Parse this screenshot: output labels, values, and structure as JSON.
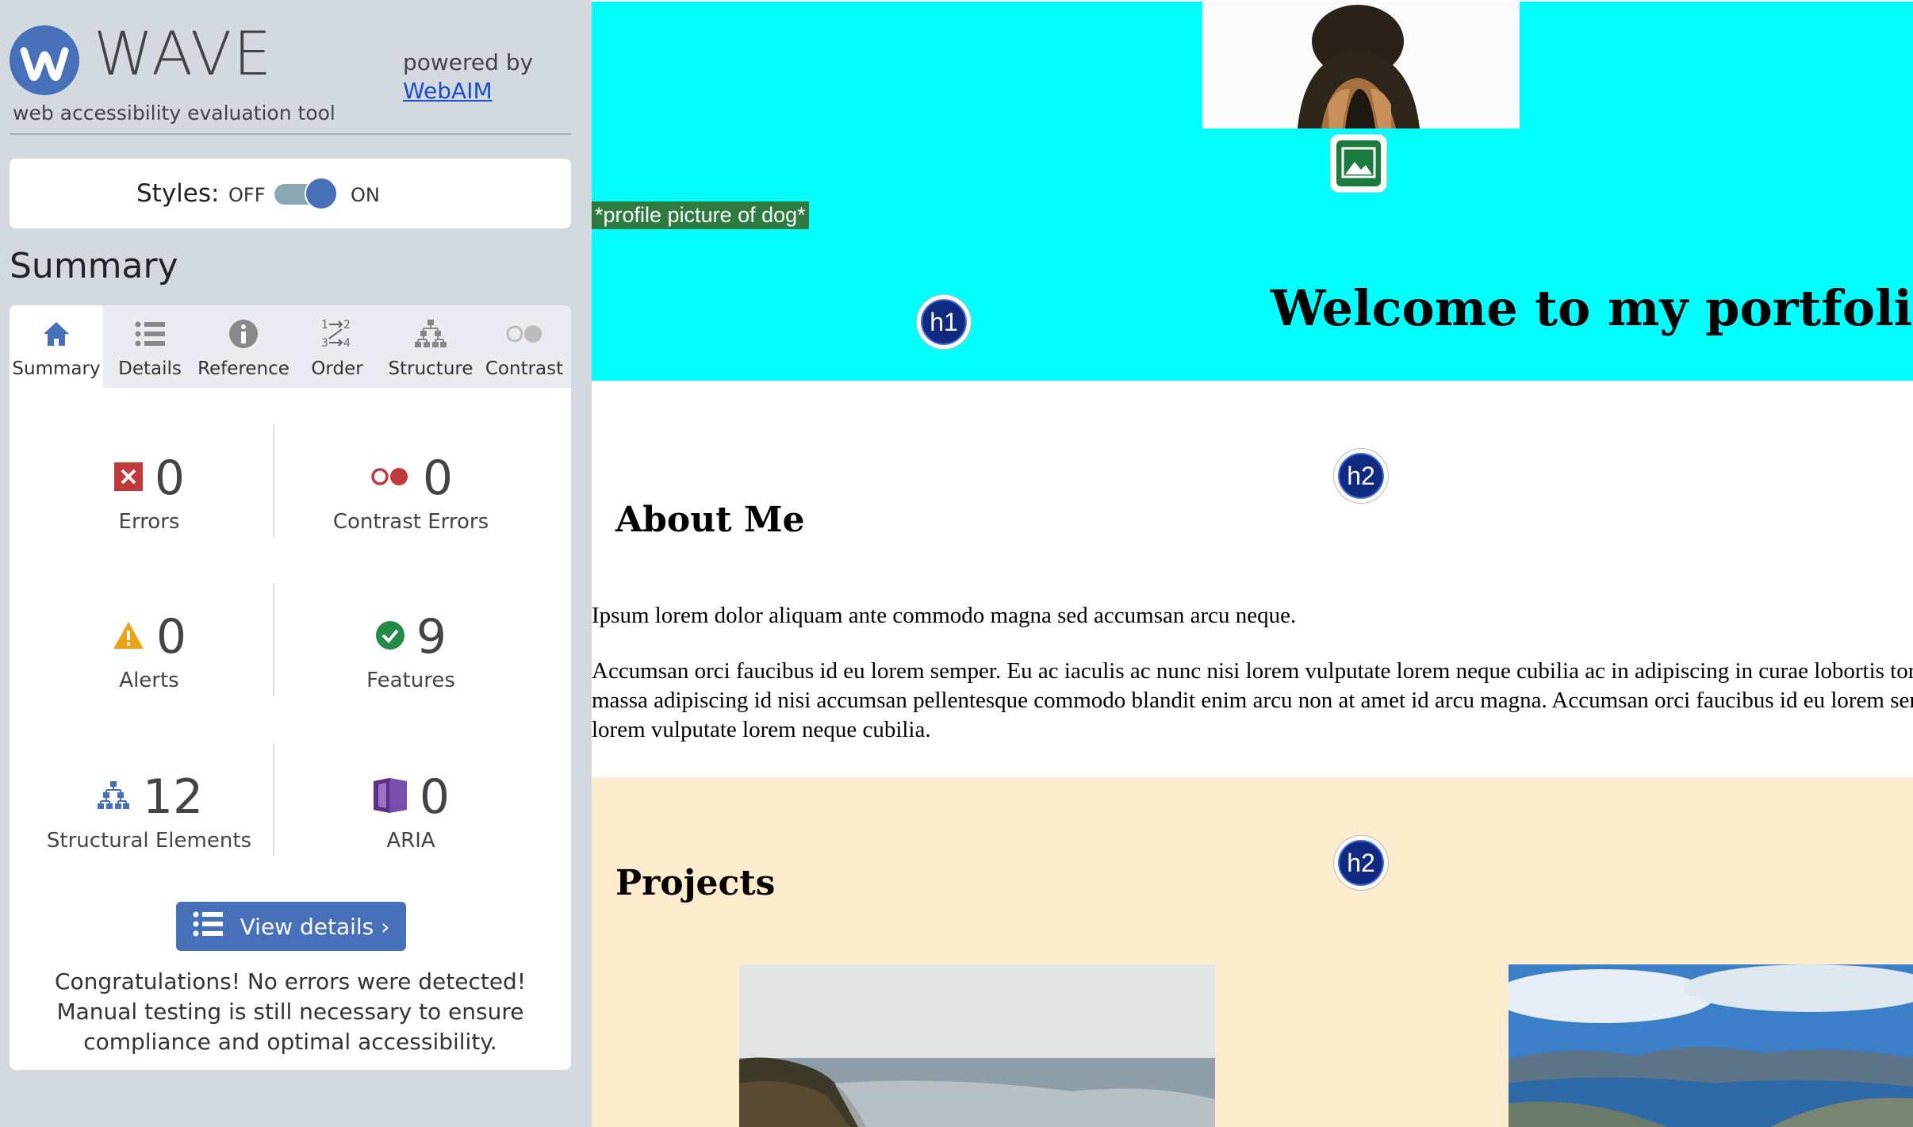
{
  "wave": {
    "logo_text": "WAVE",
    "subtitle": "web accessibility evaluation tool",
    "powered_by": "powered by",
    "webaim_link": "WebAIM",
    "styles": {
      "label": "Styles:",
      "off": "OFF",
      "on": "ON",
      "state": "on"
    },
    "summary_heading": "Summary",
    "tabs": [
      {
        "label": "Summary",
        "icon": "home-icon",
        "active": true
      },
      {
        "label": "Details",
        "icon": "list-icon",
        "active": false
      },
      {
        "label": "Reference",
        "icon": "info-icon",
        "active": false
      },
      {
        "label": "Order",
        "icon": "order-icon",
        "active": false
      },
      {
        "label": "Structure",
        "icon": "structure-icon",
        "active": false
      },
      {
        "label": "Contrast",
        "icon": "contrast-icon",
        "active": false
      }
    ],
    "stats": {
      "errors": {
        "count": "0",
        "label": "Errors",
        "icon": "error-icon",
        "color": "#c0393b"
      },
      "contrast_errors": {
        "count": "0",
        "label": "Contrast Errors",
        "icon": "contrast-error-icon",
        "color": "#c0393b"
      },
      "alerts": {
        "count": "0",
        "label": "Alerts",
        "icon": "alert-icon",
        "color": "#e8a317"
      },
      "features": {
        "count": "9",
        "label": "Features",
        "icon": "feature-check-icon",
        "color": "#238a4a"
      },
      "structural": {
        "count": "12",
        "label": "Structural Elements",
        "icon": "structure-icon",
        "color": "#4671b8"
      },
      "aria": {
        "count": "0",
        "label": "ARIA",
        "icon": "aria-icon",
        "color": "#5b2e8a"
      }
    },
    "view_details": "View details ›",
    "congrats": "Congratulations! No errors were detected! Manual testing is still necessary to ensure compliance and optimal accessibility."
  },
  "page": {
    "alt_text": "*profile picture of dog*",
    "h1_marker": "h1",
    "h2_marker": "h2",
    "hero_heading": "Welcome to my portfolio w",
    "about_heading": "About Me",
    "about_p1": "Ipsum lorem dolor aliquam ante commodo magna sed accumsan arcu neque.",
    "about_p2": "Accumsan orci faucibus id eu lorem semper. Eu ac iaculis ac nunc nisi lorem vulputate lorem neque cubilia ac in adipiscing in curae lobortis tortor primis integer massa adipiscing id nisi accumsan pellentesque commodo blandit enim arcu non at amet id arcu magna. Accumsan orci faucibus id eu lorem semper nunc nisi lorem vulputate lorem neque cubilia.",
    "projects_heading": "Projects",
    "colors": {
      "hero_bg": "#00ffff",
      "projects_bg": "#ffebcd",
      "wave_blue": "#4671b8"
    }
  }
}
